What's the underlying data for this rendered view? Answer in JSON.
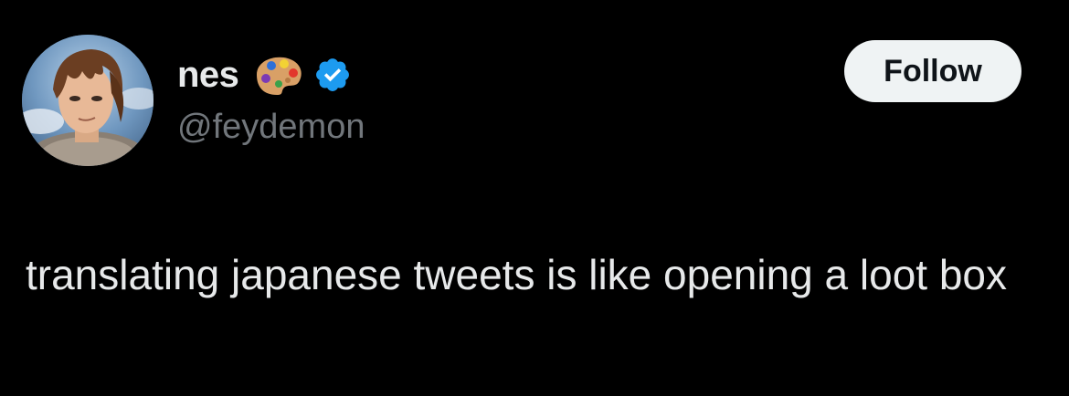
{
  "author": {
    "display_name": "nes",
    "handle": "@feydemon",
    "emoji": "palette-emoji",
    "verified_icon": "verified-badge-icon",
    "verified_color": "#1d9bf0"
  },
  "actions": {
    "follow_label": "Follow"
  },
  "tweet": {
    "text": "translating japanese tweets is like opening a loot box"
  },
  "colors": {
    "background": "#000000",
    "primary_text": "#e7e9ea",
    "secondary_text": "#71767b",
    "follow_button_bg": "#eff3f4",
    "follow_button_text": "#0f1419"
  }
}
